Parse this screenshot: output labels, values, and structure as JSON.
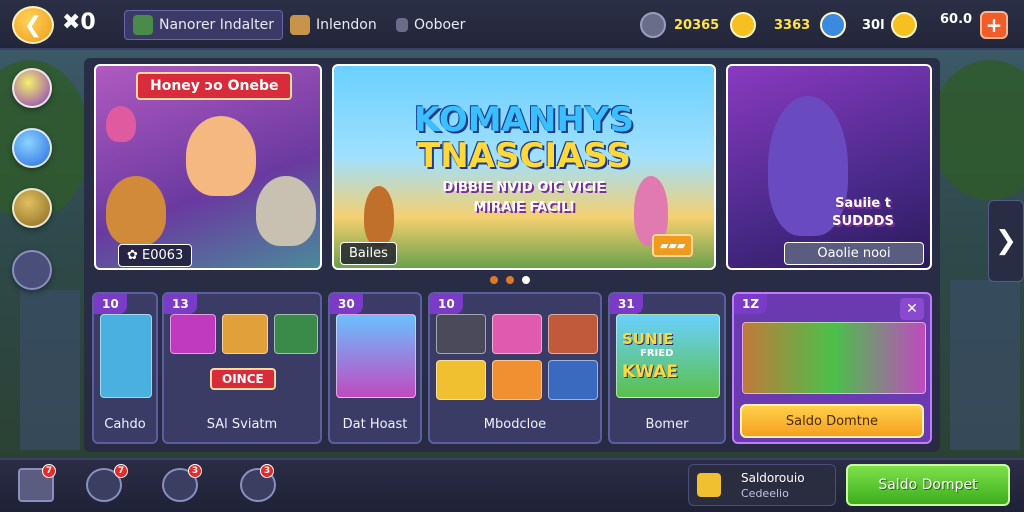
{
  "topbar": {
    "close_count": "✖0",
    "tabs": [
      {
        "label": "Nanorer  Indalter"
      },
      {
        "label": "Inlendon"
      },
      {
        "label": "Ooboer"
      }
    ],
    "currencies": [
      {
        "value": "20365"
      },
      {
        "value": "3363"
      },
      {
        "value": "30l"
      },
      {
        "value": "60.0"
      }
    ]
  },
  "banners": {
    "left": {
      "label": "Honey ɔo Onebe",
      "footer": "✿ E0063"
    },
    "center": {
      "title_line1": "KOMANHYS",
      "title_line2": "TNASCIASS",
      "subtitle_line1": "DIBBIE NVID OIC VICIE",
      "subtitle_line2": "MIRAIE FACILI",
      "footer": "Bailes"
    },
    "right": {
      "caption_line1": "Sauiie t",
      "caption_line2": "SUDDDS",
      "footer": "Oaolie nooi"
    }
  },
  "cards": [
    {
      "num": "10",
      "title": "Cahdo"
    },
    {
      "num": "13",
      "title": "SAl Sviatm",
      "inner_label": "OINCE"
    },
    {
      "num": "30",
      "title": "Dat Hoast"
    },
    {
      "num": "10",
      "title": "Mbodcloe"
    },
    {
      "num": "31",
      "title": "Bomer",
      "art_line1": "SUNIE",
      "art_line2": "FRIED",
      "art_line3": "KWAE"
    },
    {
      "num": "1Z",
      "title": "",
      "button": "Saldo Domtne"
    }
  ],
  "bottom": {
    "badges": [
      "7",
      "7",
      "3",
      "3"
    ],
    "profile_line1": "Saldorouio",
    "profile_line2": "Cedeelio",
    "primary_button": "Saldo Dompet"
  },
  "icons": [
    "back-arrow-icon",
    "close-icon",
    "coin-icon",
    "gem-icon",
    "plus-icon",
    "home-icon",
    "chevron-right-icon"
  ]
}
